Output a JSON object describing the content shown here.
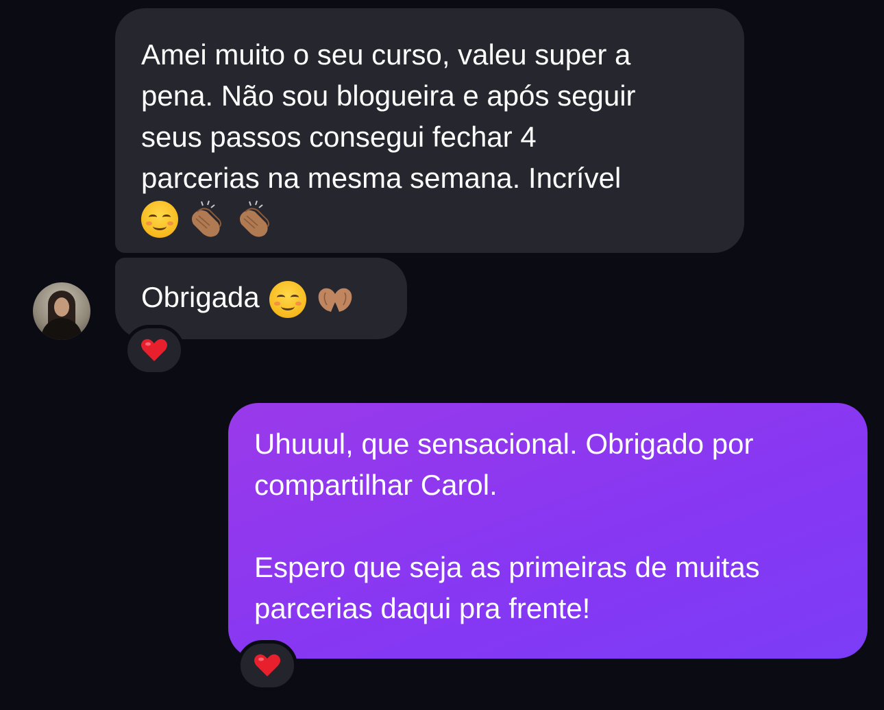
{
  "messages": [
    {
      "direction": "incoming",
      "lines": [
        "Amei muito o seu curso, valeu super a",
        "pena. Não sou blogueira e após seguir",
        "seus passos consegui fechar 4",
        "parcerias na mesma semana. Incrível"
      ],
      "emojis": [
        "smiling-face",
        "clapping-hands",
        "clapping-hands"
      ]
    },
    {
      "direction": "incoming",
      "text": "Obrigada",
      "emojis": [
        "smiling-face",
        "heart-hands"
      ],
      "reaction": "red-heart"
    },
    {
      "direction": "outgoing",
      "lines": [
        "Uhuuul, que sensacional. Obrigado por",
        "compartilhar Carol.",
        "",
        "Espero que seja as primeiras de muitas",
        "parcerias daqui pra frente!"
      ],
      "reaction": "red-heart"
    }
  ],
  "colors": {
    "background": "#0b0b14",
    "incoming_bubble": "#26262e",
    "outgoing_bubble_start": "#9a3aea",
    "outgoing_bubble_end": "#7c3cf7",
    "heart": "#e8202e"
  }
}
